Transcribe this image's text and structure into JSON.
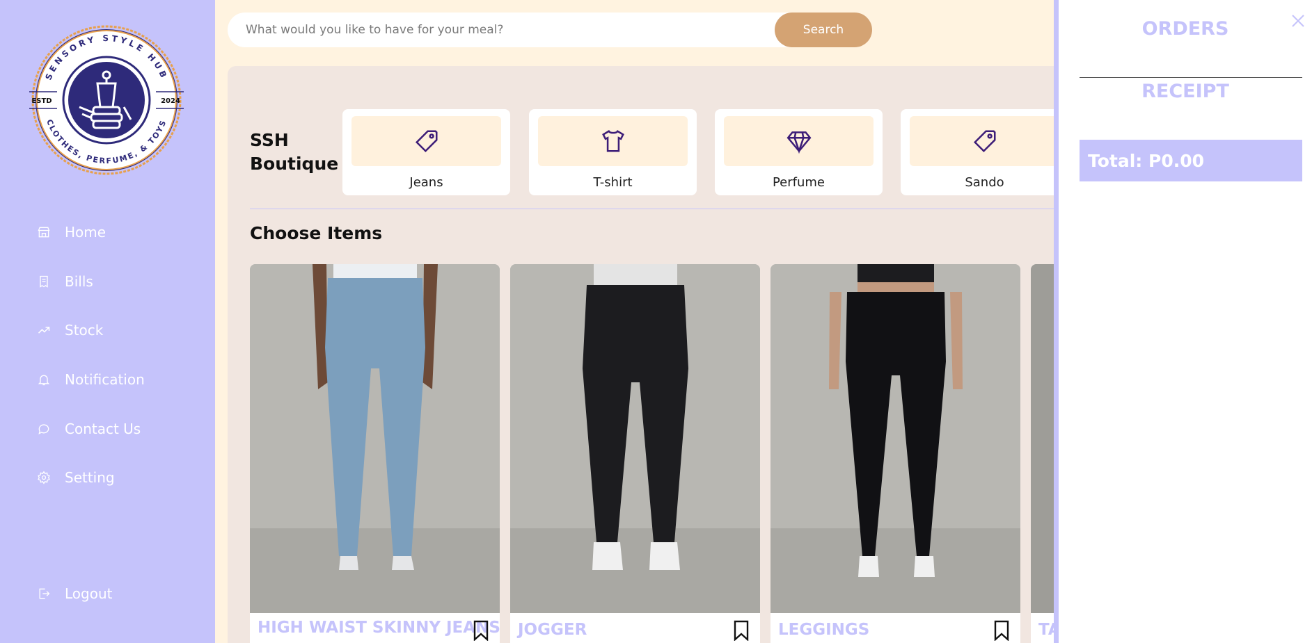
{
  "brand": {
    "logo_text_top": "SENSORY STYLE HUB",
    "logo_text_bottom": "CLOTHES, PERFUME, & TOYS",
    "logo_estd": "ESTD",
    "logo_year": "2024"
  },
  "sidebar": {
    "items": [
      {
        "label": "Home",
        "icon": "store-icon"
      },
      {
        "label": "Bills",
        "icon": "receipt-icon"
      },
      {
        "label": "Stock",
        "icon": "trend-icon"
      },
      {
        "label": "Notification",
        "icon": "bell-icon"
      },
      {
        "label": "Contact Us",
        "icon": "chat-icon"
      },
      {
        "label": "Setting",
        "icon": "gear-icon"
      }
    ],
    "logout_label": "Logout"
  },
  "search": {
    "placeholder": "What would you like to have for your meal?",
    "button_label": "Search"
  },
  "boutique_title": "SSH Boutique",
  "categories": [
    {
      "label": "Jeans",
      "icon": "tag-icon"
    },
    {
      "label": "T-shirt",
      "icon": "tshirt-icon"
    },
    {
      "label": "Perfume",
      "icon": "diamond-icon"
    },
    {
      "label": "Sando",
      "icon": "tag-icon"
    }
  ],
  "choose_items_title": "Choose Items",
  "products": [
    {
      "name": "HIGH WAIST SKINNY JEANS"
    },
    {
      "name": "JOGGER"
    },
    {
      "name": "LEGGINGS"
    },
    {
      "name": "TA"
    }
  ],
  "orders": {
    "title": "ORDERS",
    "receipt_title": "RECEIPT",
    "total_label": "Total: P0.00"
  },
  "colors": {
    "sidebar_bg": "#c5c3fb",
    "page_bg": "#fff3e0",
    "panel_bg": "#f1e6e0",
    "accent": "#d4a373",
    "icon_purple": "#3d1d78"
  }
}
